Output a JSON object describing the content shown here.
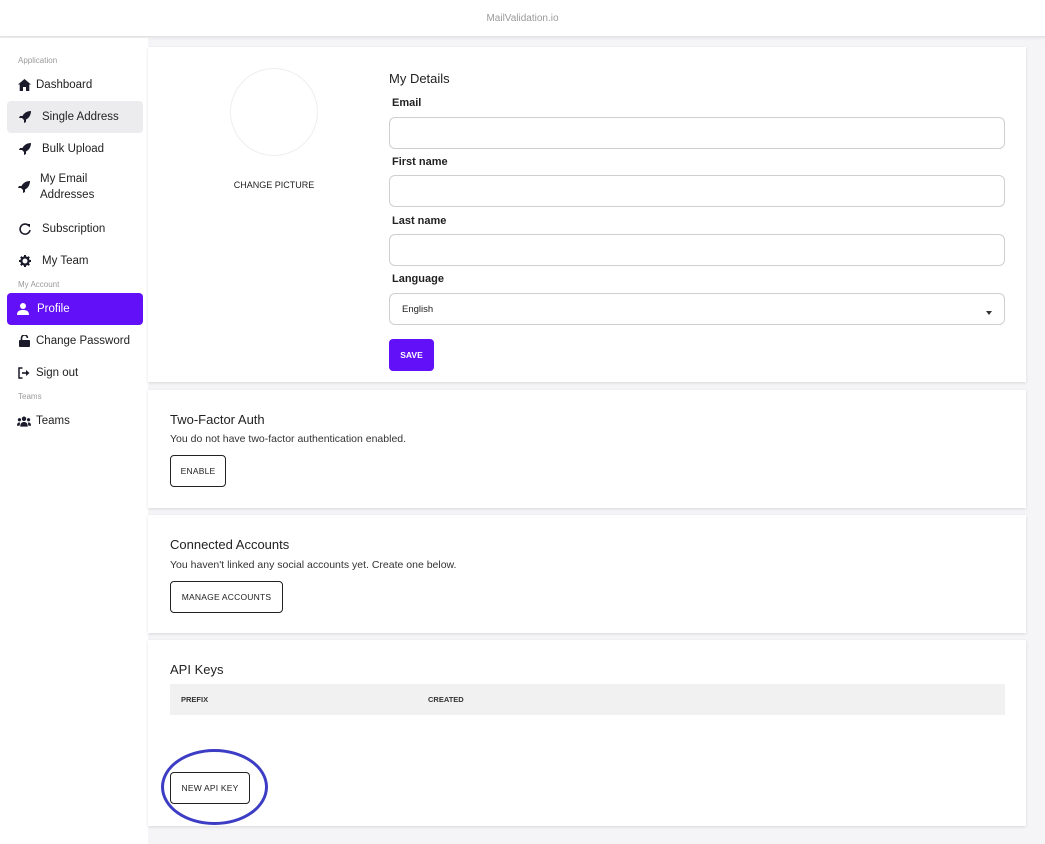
{
  "app": {
    "title": "MailValidation.io"
  },
  "sidebar": {
    "sections": [
      {
        "label": "Application"
      },
      {
        "label": "My Account"
      },
      {
        "label": "Teams"
      }
    ],
    "items": [
      {
        "label": "Dashboard",
        "icon": "home-icon"
      },
      {
        "label": "Single Address",
        "icon": "rocket-icon"
      },
      {
        "label": "Bulk Upload",
        "icon": "rocket-icon"
      },
      {
        "label": "My Email Addresses",
        "icon": "rocket-icon"
      },
      {
        "label": "Subscription",
        "icon": "refresh-icon"
      },
      {
        "label": "My Team",
        "icon": "gear-icon"
      },
      {
        "label": "Profile",
        "icon": "user-icon"
      },
      {
        "label": "Change Password",
        "icon": "unlock-icon"
      },
      {
        "label": "Sign out",
        "icon": "sign-out-icon"
      },
      {
        "label": "Teams",
        "icon": "users-icon"
      }
    ]
  },
  "profile": {
    "change_picture": "CHANGE PICTURE",
    "title": "My Details",
    "email_label": "Email",
    "email_value": "",
    "first_name_label": "First name",
    "first_name_value": "",
    "last_name_label": "Last name",
    "last_name_value": "",
    "language_label": "Language",
    "language_value": "English",
    "save_label": "SAVE"
  },
  "two_factor": {
    "title": "Two-Factor Auth",
    "text": "You do not have two-factor authentication enabled.",
    "button": "ENABLE"
  },
  "connected": {
    "title": "Connected Accounts",
    "text": "You haven't linked any social accounts yet. Create one below.",
    "button": "MANAGE ACCOUNTS"
  },
  "api_keys": {
    "title": "API Keys",
    "columns": [
      "PREFIX",
      "CREATED"
    ],
    "button": "NEW API KEY"
  },
  "colors": {
    "accent": "#6210f7",
    "highlight_ring": "#3c3cc4"
  }
}
